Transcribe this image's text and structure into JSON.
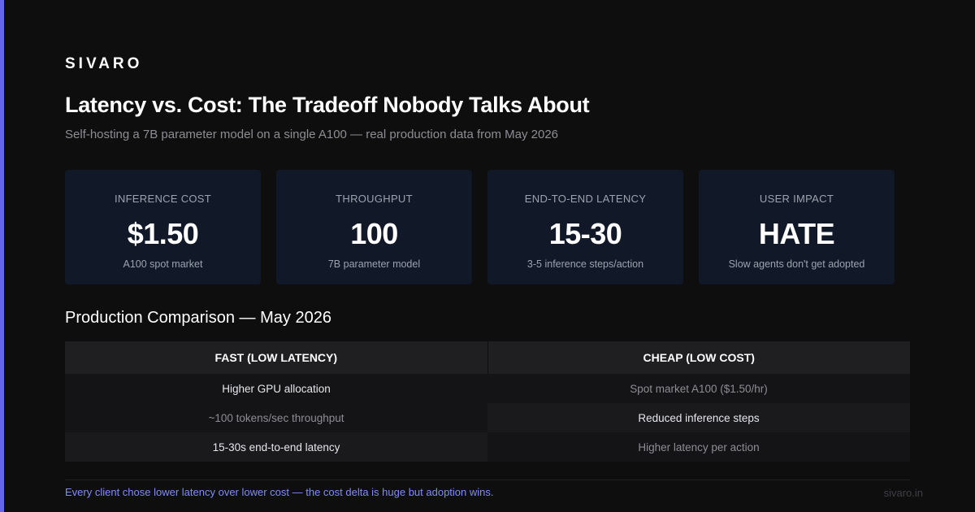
{
  "colors": {
    "background": "#0e0e0f",
    "accent": "#6366f1",
    "card_background": "#111827",
    "footer_note": "#818cf8"
  },
  "brand": "SIVARO",
  "title": "Latency vs. Cost: The Tradeoff Nobody Talks About",
  "subtitle": "Self-hosting a 7B parameter model on a single A100 — real production data from May 2026",
  "stats": [
    {
      "label": "INFERENCE COST",
      "value": "$1.50",
      "note": "A100 spot market"
    },
    {
      "label": "THROUGHPUT",
      "value": "100",
      "note": "7B parameter model"
    },
    {
      "label": "END-TO-END LATENCY",
      "value": "15-30",
      "note": "3-5 inference steps/action"
    },
    {
      "label": "USER IMPACT",
      "value": "HATE",
      "note": "Slow agents don't get adopted"
    }
  ],
  "comparison": {
    "title": "Production Comparison — May 2026",
    "headers": [
      "FAST (LOW LATENCY)",
      "CHEAP (LOW COST)"
    ],
    "rows": [
      [
        "Higher GPU allocation",
        "Spot market A100 ($1.50/hr)"
      ],
      [
        "~100 tokens/sec throughput",
        "Reduced inference steps"
      ],
      [
        "15-30s end-to-end latency",
        "Higher latency per action"
      ]
    ]
  },
  "footer": {
    "note": "Every client chose lower latency over lower cost — the cost delta is huge but adoption wins.",
    "site": "sivaro.in"
  }
}
